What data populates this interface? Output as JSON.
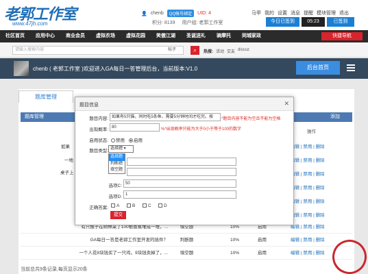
{
  "header": {
    "logo": "老郭工作室",
    "logo_url": "www.47jh.com",
    "username": "chenb",
    "qq_badge": "QQ帐号绑定",
    "uid": "UID: 4",
    "links": [
      "马甲",
      "我的",
      "设置",
      "消息",
      "提醒",
      "模块管理",
      "退出"
    ],
    "score": "积分: 8139",
    "group": "用户组: 老郭工作室",
    "checkin_button": "今日已签到",
    "clock": "05:23",
    "signed_button": "已签到"
  },
  "nav": {
    "items": [
      "社区首页",
      "应用中心",
      "商业会员",
      "虚拟农场",
      "虚拟花园",
      "笑傲江湖",
      "圣诞送礼",
      "骑摩托",
      "同城家政"
    ],
    "quick_nav": "快捷导航"
  },
  "search": {
    "placeholder": "请输入搜索内容",
    "scope": "帖子",
    "hot_label": "热搜:",
    "hot_terms": [
      "活动",
      "交友",
      "discuz"
    ]
  },
  "banner": {
    "text": "chenb ( 老郭工作室 )欢迎进入GA每日一答管理后台，当前版本:V1.0",
    "button": "后台首页"
  },
  "panel": {
    "tab": "题库管理",
    "table_head_left": "题库管理",
    "table_head_add": "添加",
    "op_header": "操作",
    "footer": "当前总共9条记录,每页显示20条",
    "stamp": "老郭工作室"
  },
  "rows": [
    {
      "question": "有只猴子在树林采了100根香蕉堆成一堆，...",
      "type": "填空题",
      "pct": "10%",
      "status": "启用",
      "ops": [
        "编辑",
        "禁用",
        "删除"
      ]
    },
    {
      "question": "GA每日一答是老郭工作室开发的插件？",
      "type": "判断题",
      "pct": "10%",
      "status": "启用",
      "ops": [
        "编辑",
        "禁用",
        "删除"
      ]
    },
    {
      "question": "一个人花8块钱买了一只鸡，9块钱卖掉了，...",
      "type": "填空题",
      "pct": "10%",
      "status": "启用",
      "ops": [
        "编辑",
        "禁用",
        "删除"
      ]
    }
  ],
  "side_rows": [
    {
      "left": "如果",
      "ops": [
        "编辑",
        "禁用",
        "删除"
      ]
    },
    {
      "left": "一地",
      "ops": [
        "编辑",
        "禁用",
        "删除"
      ]
    },
    {
      "left": "桌子上",
      "ops": [
        "编辑",
        "禁用",
        "删除"
      ]
    },
    {
      "left": "",
      "ops": [
        "编辑",
        "禁用",
        "删除"
      ]
    },
    {
      "left": "",
      "ops": [
        "编辑",
        "禁用",
        "删除"
      ]
    },
    {
      "left": "",
      "ops": [
        "编辑",
        "禁用",
        "删除"
      ]
    }
  ],
  "modal": {
    "title": "题目信息",
    "content_label": "题目内容:",
    "content_value": "如果有5只猫，同时吃5条鱼，需要5分钟时间才吃完。按",
    "content_error": "*题目内容不能为空且不能为空格",
    "rate_label": "出现概率:",
    "rate_value": "80",
    "rate_error": "%*出现概率只能为大于0小于等于100的数字",
    "status_label": "启用状态:",
    "status_off": "禁用",
    "status_on": "启用",
    "type_label": "题目类型:",
    "type_selected": "选择题",
    "type_options": [
      "选择题",
      "判断题",
      "填空题"
    ],
    "optC_label": "选项C:",
    "optC_value": "50",
    "optD_label": "选项D:",
    "optD_value": "1",
    "answer_label": "正确答案:",
    "answers": [
      "A",
      "B",
      "C",
      "D"
    ],
    "submit": "提交"
  }
}
